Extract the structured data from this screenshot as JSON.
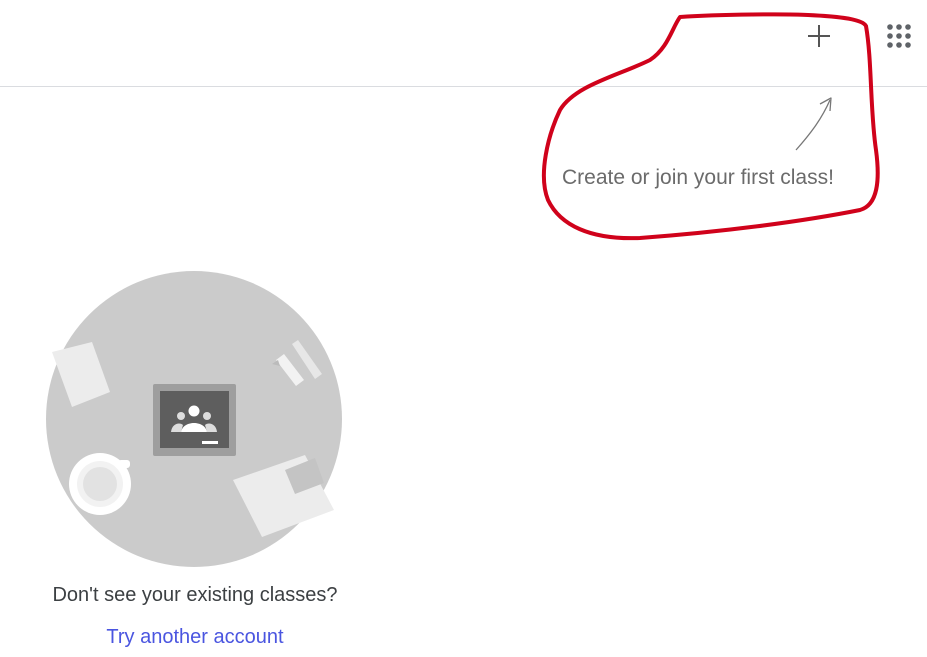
{
  "header": {
    "add_icon": "plus-icon",
    "apps_icon": "apps-grid-icon"
  },
  "hint": {
    "text": "Create or join your first class!",
    "highlight_color": "#d0021b"
  },
  "empty_state": {
    "question": "Don't see your existing classes?",
    "link": "Try another account",
    "link_color": "#4a55e0"
  }
}
